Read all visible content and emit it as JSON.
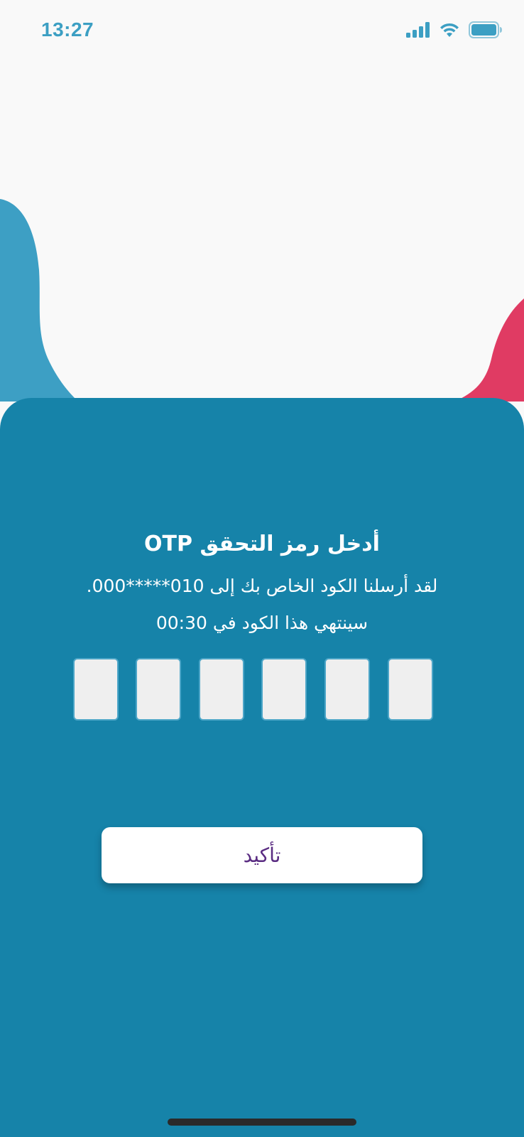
{
  "status_bar": {
    "time": "13:27",
    "signal_icon": "signal-bars-icon",
    "wifi_icon": "wifi-icon",
    "battery_icon": "battery-icon",
    "accent_color": "#3c9fc3"
  },
  "otp": {
    "title": "أدخل رمز التحقق OTP",
    "sent_message": "لقد أرسلنا الكود الخاص بك إلى 010*****000.",
    "expire_message": "سينتهي هذا الكود في 00:30",
    "digits": [
      "",
      "",
      "",
      "",
      "",
      ""
    ]
  },
  "confirm_button": {
    "label": "تأكيد"
  },
  "colors": {
    "background": "#f9f9f9",
    "panel": "#1683a9",
    "blob_left": "#3d9fc4",
    "blob_right": "#e03b63",
    "button_text": "#5a2c82"
  }
}
